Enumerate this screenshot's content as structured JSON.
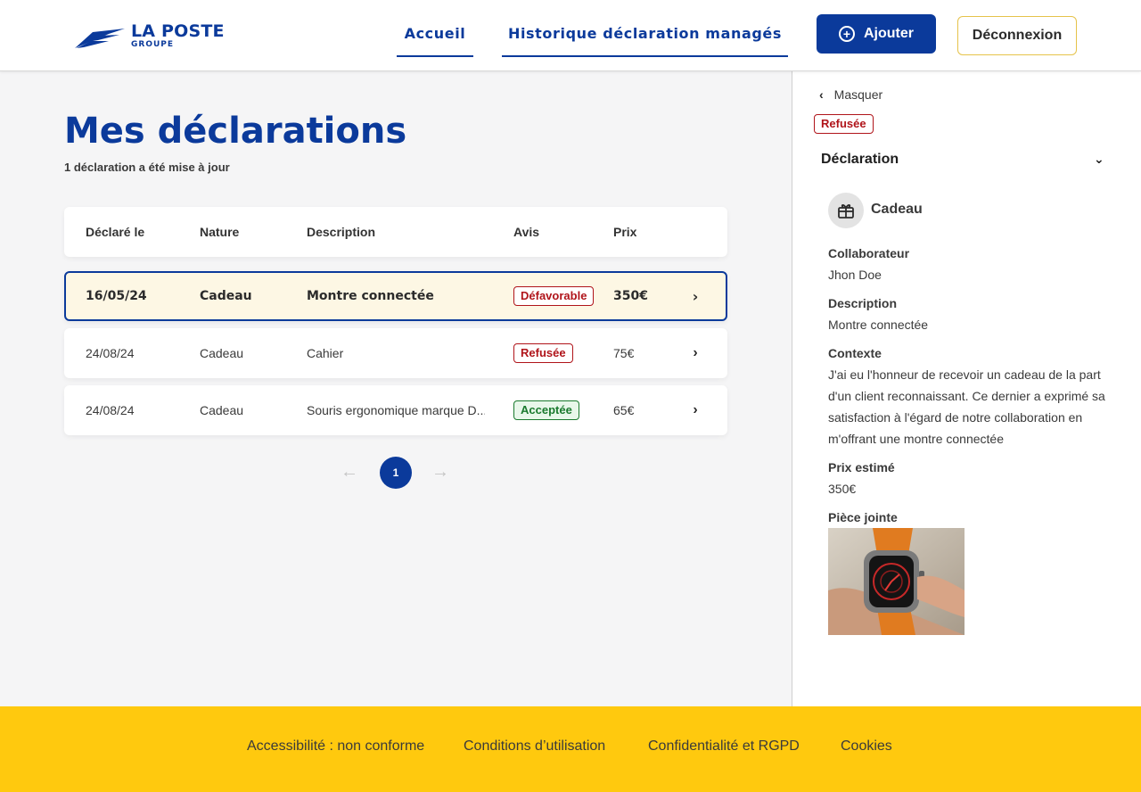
{
  "brand": {
    "name": "LA POSTE",
    "sub": "GROUPE",
    "color": "#0b3a9b"
  },
  "nav": {
    "home": "Accueil",
    "history": "Historique déclaration managés"
  },
  "actions": {
    "add_label": "Ajouter",
    "add_icon": "plus-circle-icon",
    "logout_label": "Déconnexion"
  },
  "main": {
    "title": "Mes déclarations",
    "subtitle": "1 déclaration a été mise à jour",
    "columns": [
      "Déclaré le",
      "Nature",
      "Description",
      "Avis",
      "Prix"
    ],
    "rows": [
      {
        "date": "16/05/24",
        "nature": "Cadeau",
        "description": "Montre connectée",
        "avis": "Défavorable",
        "avis_status": "red",
        "prix": "350€"
      },
      {
        "date": "24/08/24",
        "nature": "Cadeau",
        "description": "Cahier",
        "avis": "Refusée",
        "avis_status": "red",
        "prix": "75€"
      },
      {
        "date": "24/08/24",
        "nature": "Cadeau",
        "description": "Souris ergonomique marque D...",
        "avis": "Acceptée",
        "avis_status": "green",
        "prix": "65€"
      }
    ],
    "pagination": {
      "current": "1"
    }
  },
  "panel": {
    "hide_label": "Masquer",
    "status": "Refusée",
    "section_title": "Déclaration",
    "nature": "Cadeau",
    "fields": {
      "collaborator_label": "Collaborateur",
      "collaborator_value": "Jhon Doe",
      "description_label": "Description",
      "description_value": "Montre connectée",
      "context_label": "Contexte",
      "context_value": "J'ai eu l'honneur de recevoir un cadeau de la part d'un client reconnaissant. Ce dernier a exprimé sa satisfaction à l'égard de notre collaboration en m'offrant une montre connectée",
      "price_label": "Prix estimé",
      "price_value": "350€",
      "attachment_label": "Pièce jointe"
    }
  },
  "footer": {
    "links": [
      "Accessibilité : non conforme",
      "Conditions d’utilisation",
      "Confidentialité et RGPD",
      "Cookies"
    ]
  },
  "colors": {
    "primary": "#0b3a9b",
    "accent": "#ffc90e",
    "danger": "#b0141a",
    "success": "#1a7a2e"
  }
}
